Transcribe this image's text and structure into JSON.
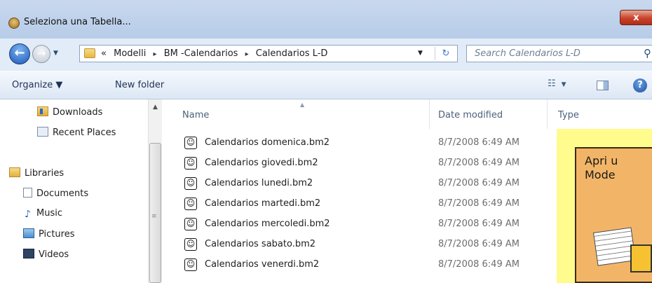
{
  "window": {
    "title": "Seleziona una Tabella...",
    "close_label": "x"
  },
  "nav": {
    "back_glyph": "←",
    "forward_glyph": "→",
    "history_glyph": "▼"
  },
  "address": {
    "overflow": "«",
    "crumbs": [
      "Modelli",
      "BM -Calendarios",
      "Calendarios L-D"
    ],
    "separator": "▸",
    "dropdown_glyph": "▼",
    "refresh_glyph": "↻"
  },
  "search": {
    "placeholder": "Search Calendarios L-D",
    "icon": "search-icon"
  },
  "toolbar": {
    "organize": "Organize ▼",
    "new_folder": "New folder",
    "views_glyph": "☷",
    "views_caret": "▼",
    "help": "?"
  },
  "sidebar": {
    "items": [
      {
        "label": "Downloads",
        "icon": "downloads-folder-icon"
      },
      {
        "label": "Recent Places",
        "icon": "recent-places-icon"
      },
      {
        "label": "Libraries",
        "icon": "libraries-icon"
      },
      {
        "label": "Documents",
        "icon": "documents-icon"
      },
      {
        "label": "Music",
        "icon": "music-icon"
      },
      {
        "label": "Pictures",
        "icon": "pictures-icon"
      },
      {
        "label": "Videos",
        "icon": "videos-icon"
      }
    ],
    "scroll_up": "▲",
    "grip": "≡"
  },
  "columns": {
    "name": "Name",
    "date": "Date modified",
    "type": "Type",
    "sort_glyph": "▲"
  },
  "files": [
    {
      "name": "Calendarios domenica.bm2",
      "date": "8/7/2008 6:49 AM"
    },
    {
      "name": "Calendarios giovedi.bm2",
      "date": "8/7/2008 6:49 AM"
    },
    {
      "name": "Calendarios lunedi.bm2",
      "date": "8/7/2008 6:49 AM"
    },
    {
      "name": "Calendarios martedi.bm2",
      "date": "8/7/2008 6:49 AM"
    },
    {
      "name": "Calendarios mercoledi.bm2",
      "date": "8/7/2008 6:49 AM"
    },
    {
      "name": "Calendarios sabato.bm2",
      "date": "8/7/2008 6:49 AM"
    },
    {
      "name": "Calendarios venerdi.bm2",
      "date": "8/7/2008 6:49 AM"
    }
  ],
  "file_icon_glyph": "☺",
  "preview": {
    "line1": "Apri u",
    "line2": "Mode",
    "bg_color": "#fffb8d",
    "card_color": "#f2b567"
  },
  "colors": {
    "titlebar": "#c8d8ee",
    "close_button": "#c7432a",
    "toolbar": "#dce7f5",
    "accent": "#1b58b8"
  }
}
